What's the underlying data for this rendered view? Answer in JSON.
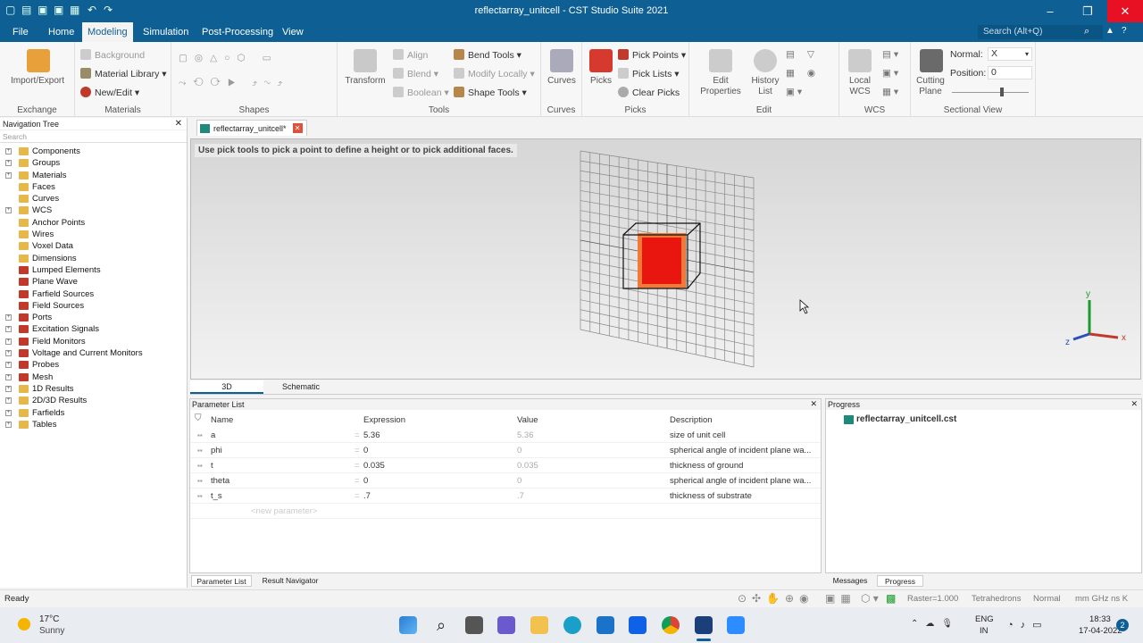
{
  "window": {
    "title": "reflectarray_unitcell - CST Studio Suite 2021"
  },
  "menu": [
    {
      "label": "File",
      "active": false
    },
    {
      "label": "Home",
      "active": false
    },
    {
      "label": "Modeling",
      "active": true
    },
    {
      "label": "Simulation",
      "active": false
    },
    {
      "label": "Post-Processing",
      "active": false
    },
    {
      "label": "View",
      "active": false
    }
  ],
  "search": {
    "placeholder": "Search (Alt+Q)"
  },
  "ribbon": {
    "exchange": {
      "label": "Exchange",
      "import_export": "Import/Export"
    },
    "materials": {
      "label": "Materials",
      "background": "Background",
      "material_library": "Material Library",
      "new_edit": "New/Edit"
    },
    "shapes": {
      "label": "Shapes"
    },
    "tools": {
      "label": "Tools",
      "transform": "Transform",
      "align": "Align",
      "blend": "Blend",
      "boolean": "Boolean",
      "bend_tools": "Bend Tools",
      "modify_locally": "Modify Locally",
      "shape_tools": "Shape Tools"
    },
    "curves": {
      "label": "Curves",
      "curves_btn": "Curves"
    },
    "picks": {
      "label": "Picks",
      "picks_btn": "Picks",
      "pick_points": "Pick Points",
      "pick_lists": "Pick Lists",
      "clear_picks": "Clear Picks"
    },
    "edit": {
      "label": "Edit",
      "edit_properties": "Edit Properties",
      "history_list": "History List"
    },
    "wcs": {
      "label": "WCS",
      "local_wcs": "Local WCS"
    },
    "sectional": {
      "label": "Sectional View",
      "cutting_plane": "Cutting Plane",
      "normal_label": "Normal:",
      "normal_value": "X",
      "position_label": "Position:",
      "position_value": "0"
    }
  },
  "nav": {
    "title": "Navigation Tree",
    "search": "Search",
    "items": [
      "Components",
      "Groups",
      "Materials",
      "Faces",
      "Curves",
      "WCS",
      "Anchor Points",
      "Wires",
      "Voxel Data",
      "Dimensions",
      "Lumped Elements",
      "Plane Wave",
      "Farfield Sources",
      "Field Sources",
      "Ports",
      "Excitation Signals",
      "Field Monitors",
      "Voltage and Current Monitors",
      "Probes",
      "Mesh",
      "1D Results",
      "2D/3D Results",
      "Farfields",
      "Tables"
    ]
  },
  "doc_tab": "reflectarray_unitcell*",
  "viewport": {
    "hint": "Use pick tools to pick a point to define a height or to pick additional faces.",
    "tabs": [
      "3D",
      "Schematic"
    ],
    "axes": {
      "x": "x",
      "y": "y",
      "z": "z"
    }
  },
  "params": {
    "title": "Parameter List",
    "columns": [
      "Name",
      "Expression",
      "Value",
      "Description"
    ],
    "rows": [
      {
        "name": "a",
        "expr": "5.36",
        "value": "5.36",
        "desc": "size of unit cell"
      },
      {
        "name": "phi",
        "expr": "0",
        "value": "0",
        "desc": "spherical angle of incident plane wa..."
      },
      {
        "name": "t",
        "expr": "0.035",
        "value": "0.035",
        "desc": "thickness of ground"
      },
      {
        "name": "theta",
        "expr": "0",
        "value": "0",
        "desc": "spherical angle of incident plane wa..."
      },
      {
        "name": "t_s",
        "expr": ".7",
        "value": ".7",
        "desc": "thickness of substrate"
      }
    ],
    "new_param": "<new parameter>",
    "tabs": [
      "Parameter List",
      "Result Navigator"
    ]
  },
  "progress": {
    "title": "Progress",
    "file": "reflectarray_unitcell.cst",
    "tabs": [
      "Messages",
      "Progress"
    ]
  },
  "status": {
    "ready": "Ready",
    "raster": "Raster=1.000",
    "mesh": "Tetrahedrons",
    "mode": "Normal",
    "units": "mm  GHz  ns  K"
  },
  "taskbar": {
    "temp": "17°C",
    "weather": "Sunny",
    "lang1": "ENG",
    "lang2": "IN",
    "time": "18:33",
    "date": "17-04-2022",
    "notif": "2"
  },
  "colors": {
    "accent": "#0e5f93",
    "cube": "#e8160e"
  }
}
